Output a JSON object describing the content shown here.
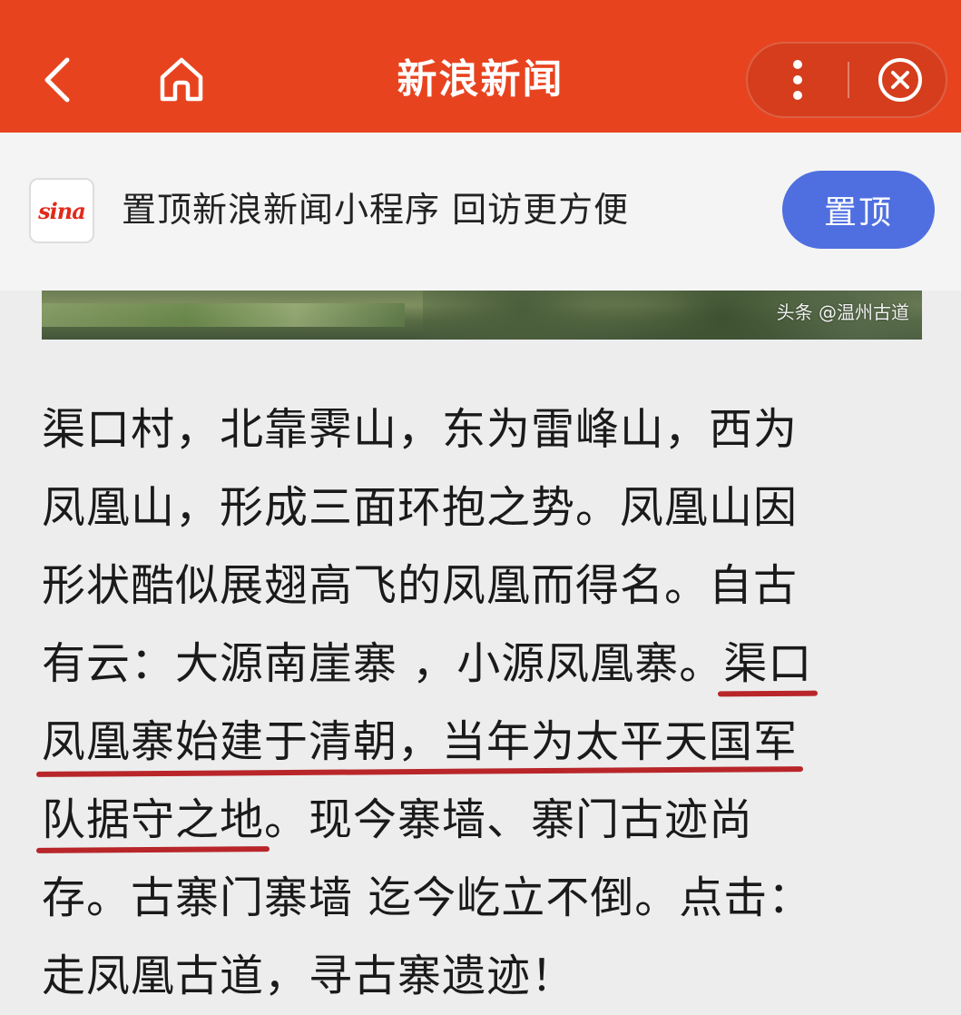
{
  "header": {
    "title": "新浪新闻",
    "back_icon": "chevron-left-icon",
    "home_icon": "home-icon",
    "more_icon": "more-vertical-icon",
    "close_icon": "close-circle-icon",
    "color": "#e8431f"
  },
  "banner": {
    "logo_text": "sina",
    "text": "置顶新浪新闻小程序 回访更方便",
    "button_label": "置顶",
    "button_color": "#4f6fe0"
  },
  "image": {
    "watermark": "头条 @温州古道"
  },
  "article": {
    "lines": [
      {
        "parts": [
          {
            "text": "渠口村，北靠霁山，东为雷峰山，西为",
            "hl": false
          }
        ]
      },
      {
        "parts": [
          {
            "text": "凤凰山，形成三面环抱之势。凤凰山因",
            "hl": false
          }
        ]
      },
      {
        "parts": [
          {
            "text": "形状酷似展翅高飞的凤凰而得名。自古",
            "hl": false
          }
        ]
      },
      {
        "parts": [
          {
            "text": "有云：大源南崖寨 ，小源凤凰寨。",
            "hl": false
          },
          {
            "text": "渠口",
            "hl": true
          }
        ]
      },
      {
        "parts": [
          {
            "text": "凤凰寨始建于清朝，当年为太平天国军",
            "hl": true
          }
        ]
      },
      {
        "parts": [
          {
            "text": "队据守之地",
            "hl": true
          },
          {
            "text": "。现今寨墙、寨门古迹尚",
            "hl": false
          }
        ]
      },
      {
        "parts": [
          {
            "text": "存。古寨门寨墙 迄今屹立不倒。点击：",
            "hl": false
          }
        ]
      },
      {
        "parts": [
          {
            "text": "走凤凰古道，寻古寨遗迹！",
            "hl": false
          }
        ]
      }
    ],
    "underline_color": "#b8262a"
  }
}
